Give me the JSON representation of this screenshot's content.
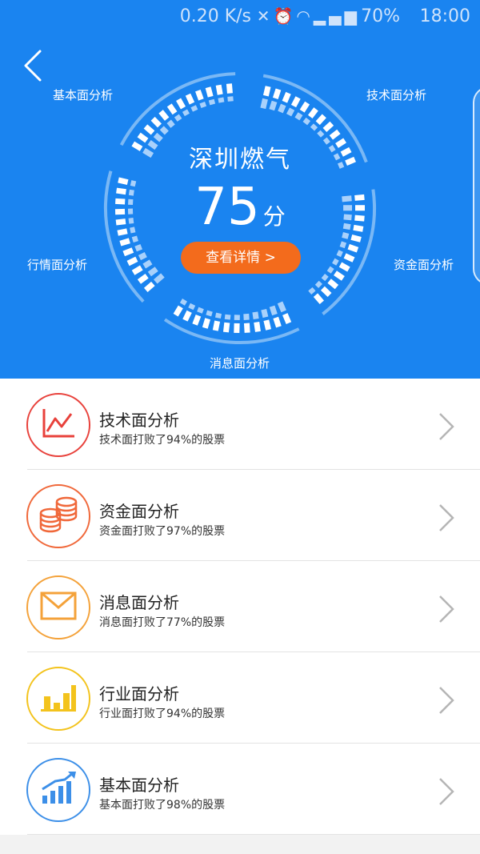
{
  "status_bar": {
    "speed": "0.20 K/s",
    "icons": [
      "mute-icon",
      "alarm-icon",
      "wifi-icon",
      "4g-icon",
      "signal-icon"
    ],
    "battery": "70%",
    "time": "18:00"
  },
  "hero": {
    "company": "深圳燃气",
    "score": "75",
    "score_unit": "分",
    "detail_button": "查看详情 >",
    "labels": {
      "jiben": "基本面分析",
      "jishu": "技术面分析",
      "hangqing": "行情面分析",
      "zijin": "资金面分析",
      "xiaoxi": "消息面分析"
    },
    "colors": {
      "background": "#1a84f0",
      "button": "#f36b1c"
    }
  },
  "items": [
    {
      "title": "技术面分析",
      "desc": "技术面打败了94%的股票",
      "color": "#e8413b",
      "icon": "line-chart-icon"
    },
    {
      "title": "资金面分析",
      "desc": "资金面打败了97%的股票",
      "color": "#f0683a",
      "icon": "coins-icon"
    },
    {
      "title": "消息面分析",
      "desc": "消息面打败了77%的股票",
      "color": "#f4a23a",
      "icon": "mail-icon"
    },
    {
      "title": "行业面分析",
      "desc": "行业面打败了94%的股票",
      "color": "#f3c31d",
      "icon": "bar-chart-icon"
    },
    {
      "title": "基本面分析",
      "desc": "基本面打败了98%的股票",
      "color": "#3c8fe8",
      "icon": "trend-up-icon"
    }
  ]
}
